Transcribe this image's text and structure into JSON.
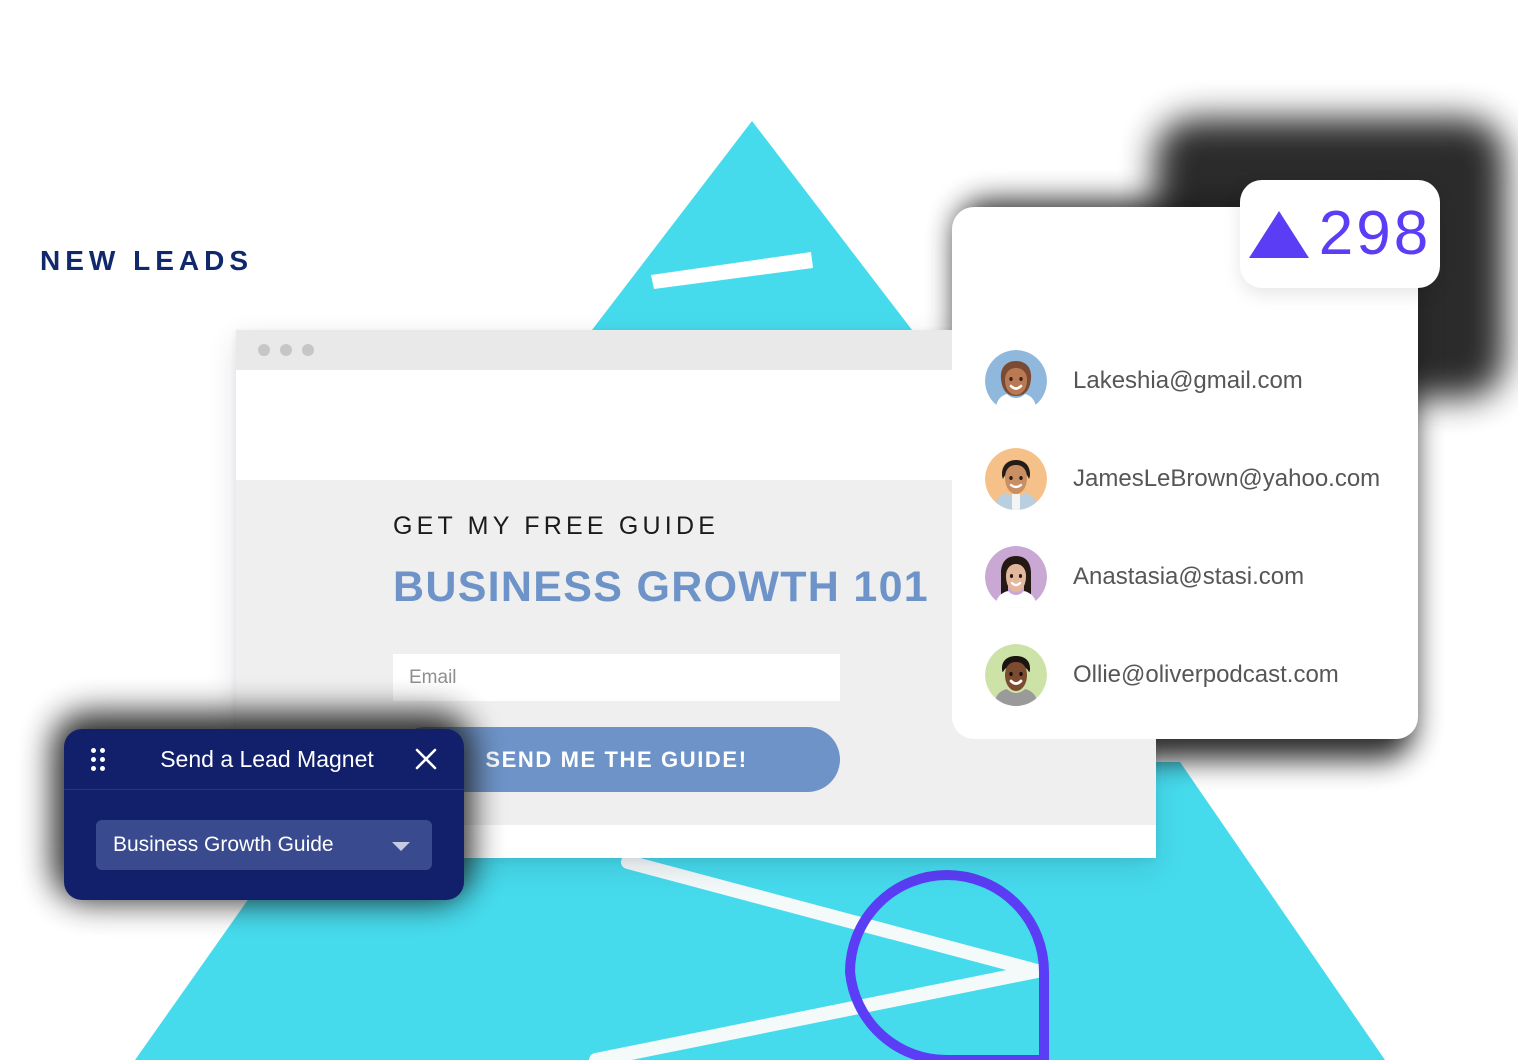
{
  "browser": {
    "dots": [
      "dot-1",
      "dot-2",
      "dot-3"
    ],
    "form": {
      "eyebrow": "GET MY FREE GUIDE",
      "headline": "BUSINESS GROWTH 101",
      "email_placeholder": "Email",
      "email_value": "",
      "submit_label": "SEND ME THE GUIDE!"
    }
  },
  "leads_card": {
    "title": "NEW LEADS",
    "badge": {
      "icon": "triangle-up-icon",
      "value": "298",
      "color": "#5b3df5"
    },
    "leads": [
      {
        "email": "Lakeshia@gmail.com",
        "avatar_bg": "#8fb8dc",
        "avatar_name": "avatar-lakeshia"
      },
      {
        "email": "JamesLeBrown@yahoo.com",
        "avatar_bg": "#f5c188",
        "avatar_name": "avatar-jameslebrown"
      },
      {
        "email": "Anastasia@stasi.com",
        "avatar_bg": "#c9a8d4",
        "avatar_name": "avatar-anastasia"
      },
      {
        "email": "Ollie@oliverpodcast.com",
        "avatar_bg": "#cde2a6",
        "avatar_name": "avatar-ollie"
      }
    ]
  },
  "lead_magnet_panel": {
    "drag_handle_icon": "drag-grip-icon",
    "title": "Send a Lead Magnet",
    "close_icon": "close-icon",
    "select_value": "Business Growth Guide",
    "caret_icon": "chevron-down-icon"
  },
  "decor": {
    "cyan": "#45dbed",
    "purple_outline": "#5b3df5",
    "accent_blue": "#6d93c8",
    "navy": "#12206b"
  }
}
